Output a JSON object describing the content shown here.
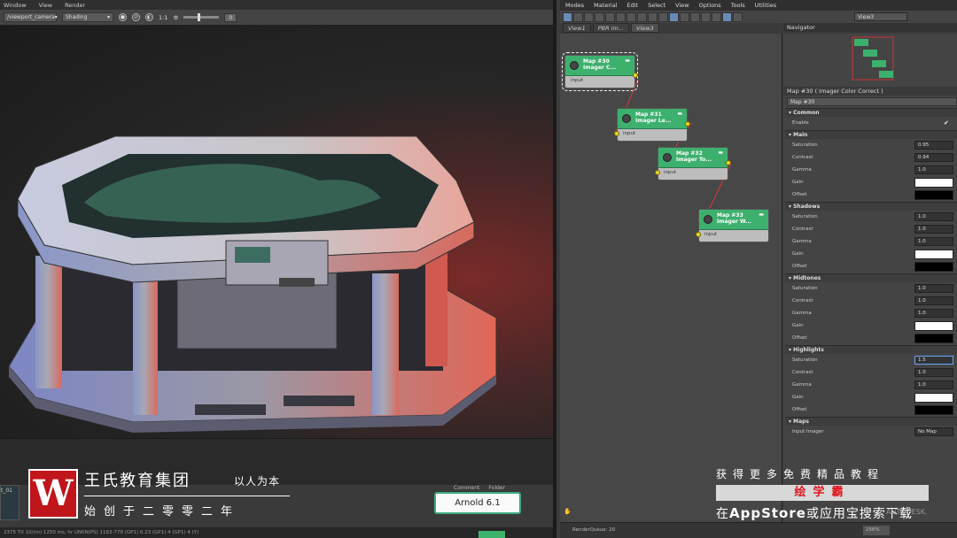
{
  "left_menu": [
    "Window",
    "View",
    "Render"
  ],
  "vp_toolbar": {
    "camera": "/viewport_camera",
    "shading": "Shading",
    "ratio": "1:1",
    "field_value": "0"
  },
  "thumbnail_label": "t_01",
  "comment_tabs": [
    "Comment",
    "Folder"
  ],
  "arnold_label": "Arnold 6.1",
  "status_left": "2375 TX 10/(m) 1250 ms, hr  UNKN(PS) 1163-778 (GP1) 0.23 (GP1) 4 (GP1) 4 (Y)",
  "brand": {
    "logo_letter": "W",
    "title": "王氏教育集团",
    "motto": "以人为本",
    "subtitle": "始创于二零零二年"
  },
  "slate": {
    "menu": [
      "Modes",
      "Material",
      "Edit",
      "Select",
      "View",
      "Options",
      "Tools",
      "Utilities"
    ],
    "view_select": "View3",
    "view_tabs": [
      "View1",
      "PBR im...",
      "View3"
    ],
    "active_tab_index": 2,
    "nodes": [
      {
        "title1": "Map #30",
        "title2": "Imager C...",
        "input": "input"
      },
      {
        "title1": "Map #31",
        "title2": "Imager Le...",
        "input": "input"
      },
      {
        "title1": "Map #32",
        "title2": "Imager To...",
        "input": "input"
      },
      {
        "title1": "Map #33",
        "title2": "Imager W...",
        "input": "input"
      }
    ],
    "navigator_title": "Navigator",
    "props_header": "Map #30  ( Imager Color Correct )",
    "props_name": "Map #30",
    "common": {
      "title": "Common",
      "enable_label": "Enable",
      "enable_check": "✔"
    },
    "main": {
      "title": "Main",
      "rows": [
        {
          "label": "Saturation",
          "value": "0.95"
        },
        {
          "label": "Contrast",
          "value": "0.94"
        },
        {
          "label": "Gamma",
          "value": "1.0"
        }
      ],
      "gain": "Gain",
      "offset": "Offset"
    },
    "shadows": {
      "title": "Shadows",
      "rows": [
        {
          "label": "Saturation",
          "value": "1.0"
        },
        {
          "label": "Contrast",
          "value": "1.0"
        },
        {
          "label": "Gamma",
          "value": "1.0"
        }
      ],
      "gain": "Gain",
      "offset": "Offset"
    },
    "midtones": {
      "title": "Midtones",
      "rows": [
        {
          "label": "Saturation",
          "value": "1.0"
        },
        {
          "label": "Contrast",
          "value": "1.0"
        },
        {
          "label": "Gamma",
          "value": "1.0"
        }
      ],
      "gain": "Gain",
      "offset": "Offset"
    },
    "highlights": {
      "title": "Highlights",
      "rows": [
        {
          "label": "Saturation",
          "value": "1.5"
        },
        {
          "label": "Contrast",
          "value": "1.0"
        },
        {
          "label": "Gamma",
          "value": "1.0"
        }
      ],
      "gain": "Gain",
      "offset": "Offset"
    },
    "maps": {
      "title": "Maps",
      "input_label": "Input Imager",
      "no_map": "No Map"
    },
    "render_queue": "RenderQueue: 20",
    "zoom": "156%"
  },
  "promo": {
    "line1": "获得更多免费精品教程",
    "bar": "绘学霸",
    "line2_prefix": "在",
    "line2_app": "AppStore",
    "line2_mid": "或",
    "line2_suffix": "应用宝搜索下载",
    "watermark": "AUTODESK."
  },
  "colors": {
    "node_green": "#3db06e",
    "arnold_border": "#3dab7d",
    "brand_red": "#c1151c",
    "promo_red": "#e1161f"
  }
}
